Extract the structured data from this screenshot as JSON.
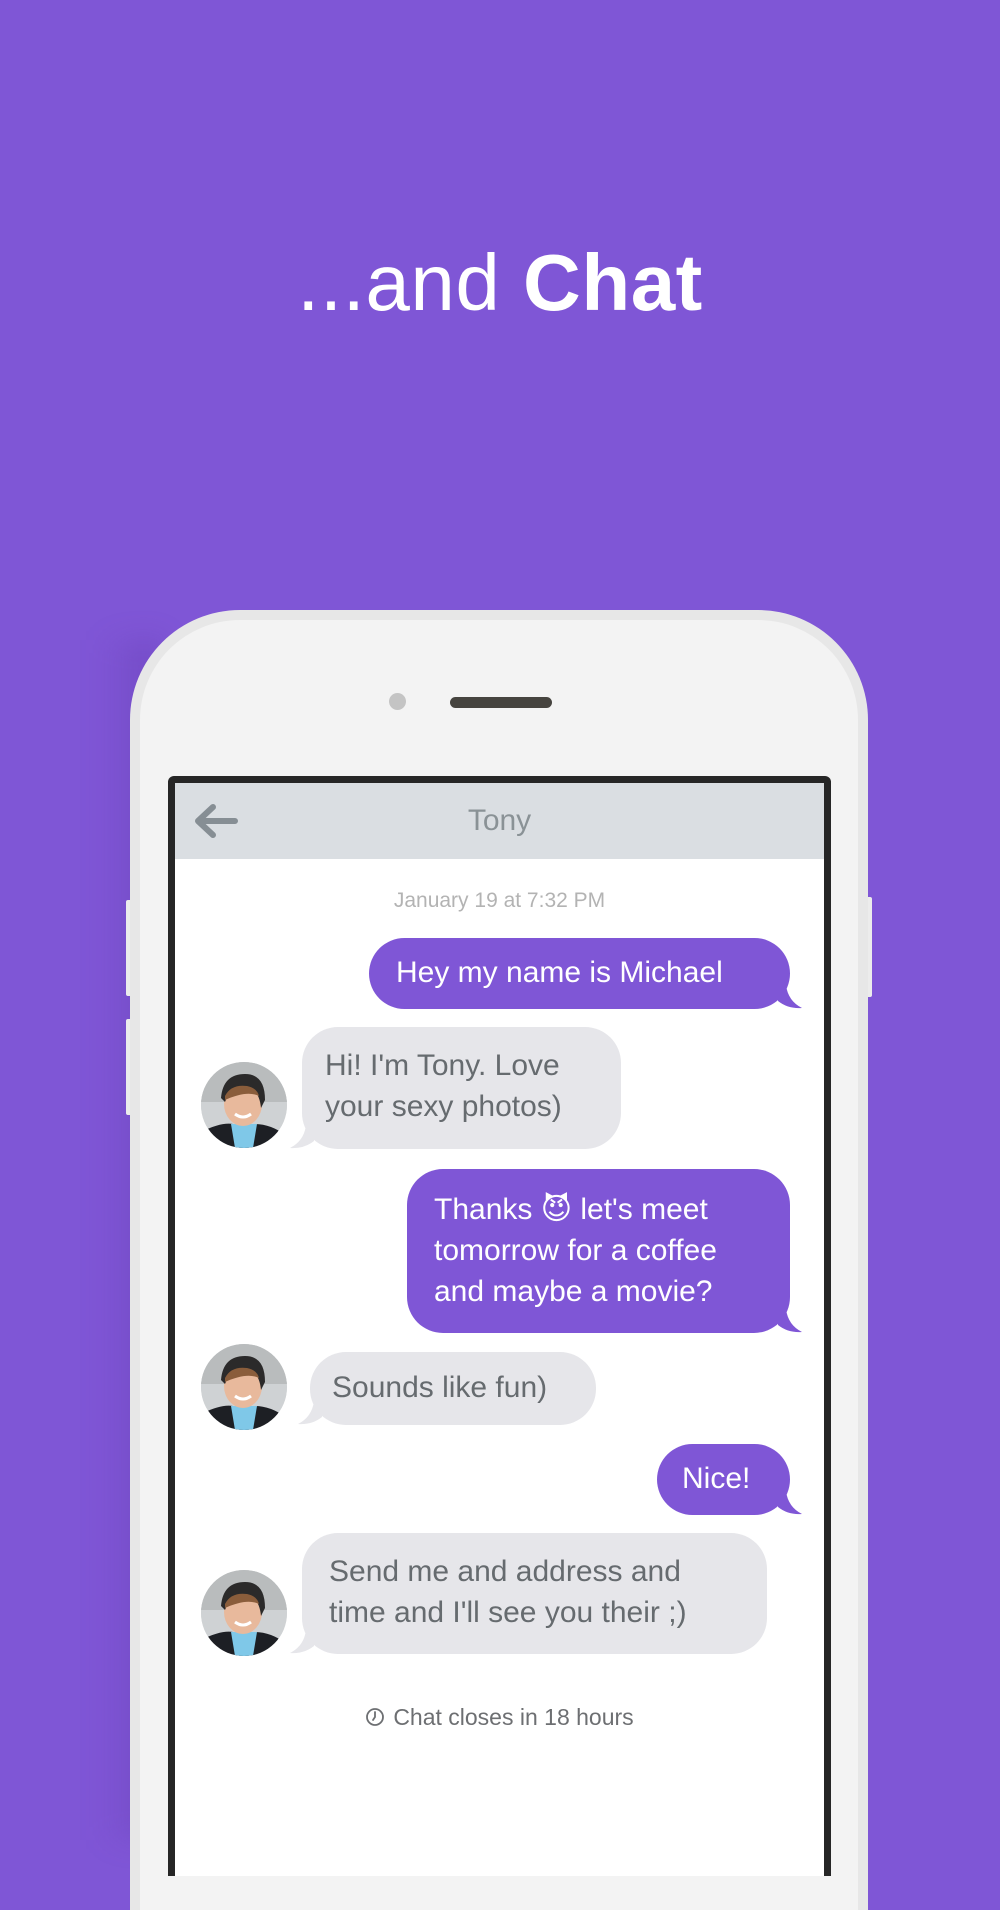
{
  "headline": {
    "prefix": "...and ",
    "emphasis": "Chat"
  },
  "chat": {
    "contact_name": "Tony",
    "back_icon": "arrow-left-icon",
    "timestamp": "January 19 at 7:32 PM",
    "messages": [
      {
        "direction": "outgoing",
        "lines": [
          "Hey my name is Michael"
        ]
      },
      {
        "direction": "incoming",
        "lines": [
          "Hi! I'm Tony. Love",
          "your sexy photos)"
        ],
        "avatar": "avatar-tony"
      },
      {
        "direction": "outgoing",
        "lines": [
          "Thanks",
          "let's meet",
          "tomorrow for a coffee",
          "and maybe a movie?"
        ],
        "emoji": "😈"
      },
      {
        "direction": "incoming",
        "lines": [
          "Sounds like fun)"
        ],
        "avatar": "avatar-tony"
      },
      {
        "direction": "outgoing",
        "lines": [
          "Nice!"
        ]
      },
      {
        "direction": "incoming",
        "lines": [
          "Send me and address and",
          "time and I'll see you their ;)"
        ],
        "avatar": "avatar-tony"
      }
    ],
    "footer_icon": "clock-icon",
    "footer_text": "Chat closes in 18 hours"
  },
  "colors": {
    "brand_purple": "#7f56d6",
    "incoming_bubble": "#e6e6ea",
    "nav_bar": "#dadee2"
  }
}
